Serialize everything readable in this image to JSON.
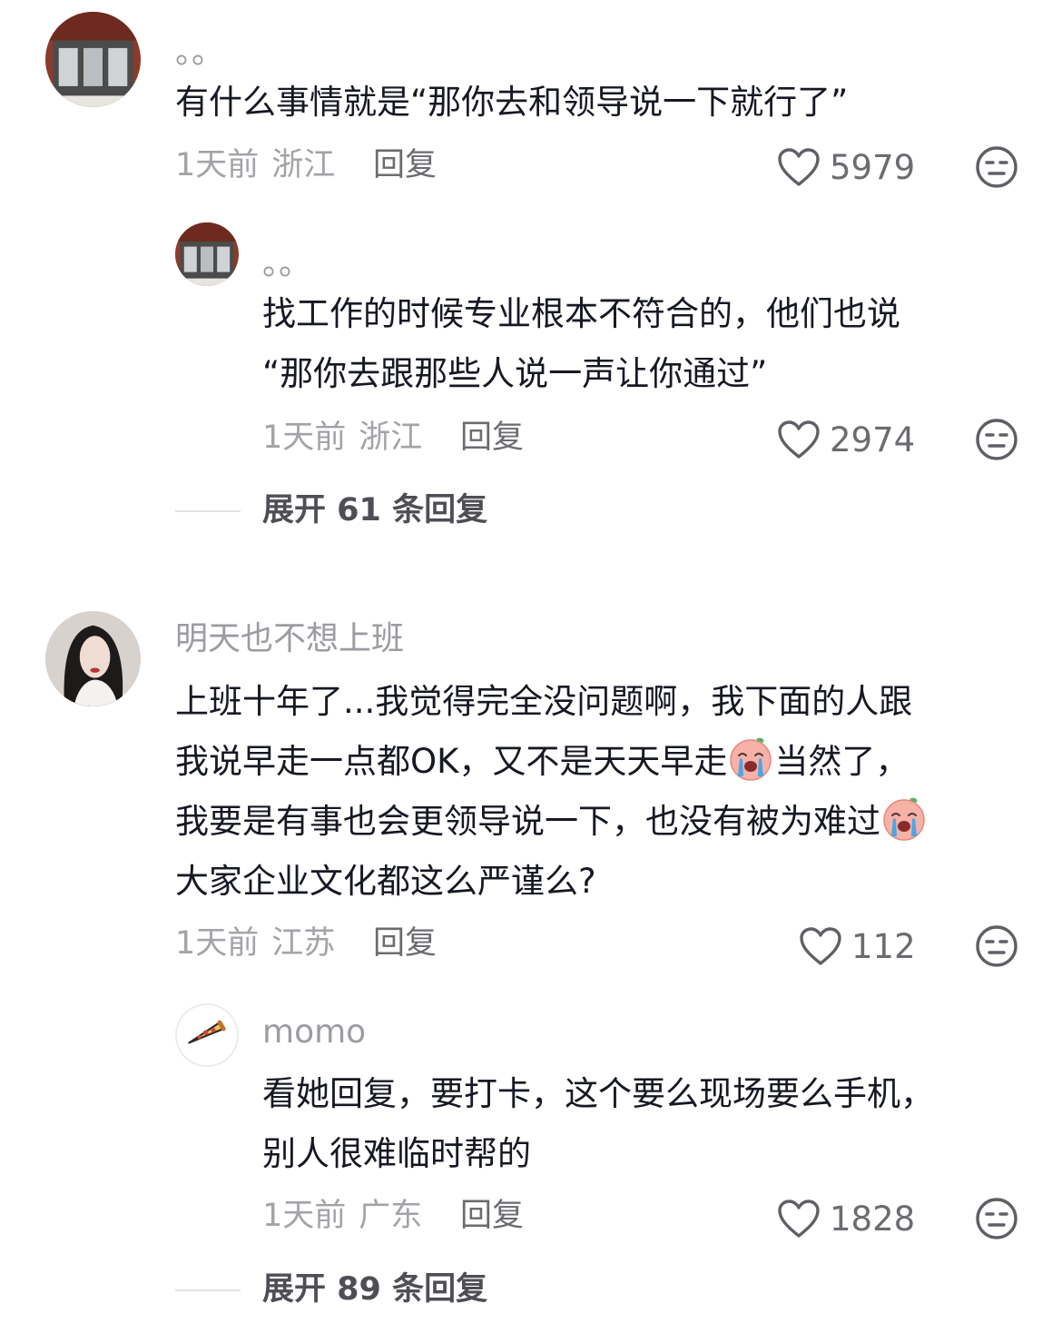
{
  "comments": [
    {
      "username": "。。",
      "text": "有什么事情就是“那你去和领导说一下就行了”",
      "time": "1天前",
      "location": "浙江",
      "reply_label": "回复",
      "likes": "5979",
      "replies": [
        {
          "username": "。。",
          "text_line1": "找工作的时候专业根本不符合的，他们也说",
          "text_line2": "“那你去跟那些人说一声让你通过”",
          "time": "1天前",
          "location": "浙江",
          "reply_label": "回复",
          "likes": "2974"
        }
      ],
      "expand_label": "展开 61 条回复"
    },
    {
      "username": "明天也不想上班",
      "text_line1": "上班十年了...我觉得完全没问题啊，我下面的人跟",
      "text_line2a": "我说早走一点都OK，又不是天天早走",
      "text_line2b": "当然了，",
      "text_line3": "我要是有事也会更领导说一下，也没有被为难过",
      "text_line4": "大家企业文化都这么严谨么?",
      "time": "1天前",
      "location": "江苏",
      "reply_label": "回复",
      "likes": "112",
      "replies": [
        {
          "username": "momo",
          "text_line1": "看她回复，要打卡，这个要么现场要么手机，",
          "text_line2": "别人很难临时帮的",
          "time": "1天前",
          "location": "广东",
          "reply_label": "回复",
          "likes": "1828"
        }
      ],
      "expand_label": "展开 89 条回复"
    }
  ],
  "icons": {
    "like": "heart-outline-icon",
    "dislike": "meh-face-icon",
    "emoji": "crying-face-emoji"
  },
  "colors": {
    "text": "#161823",
    "meta": "#a3a3a8",
    "username": "#9b9ba1"
  }
}
